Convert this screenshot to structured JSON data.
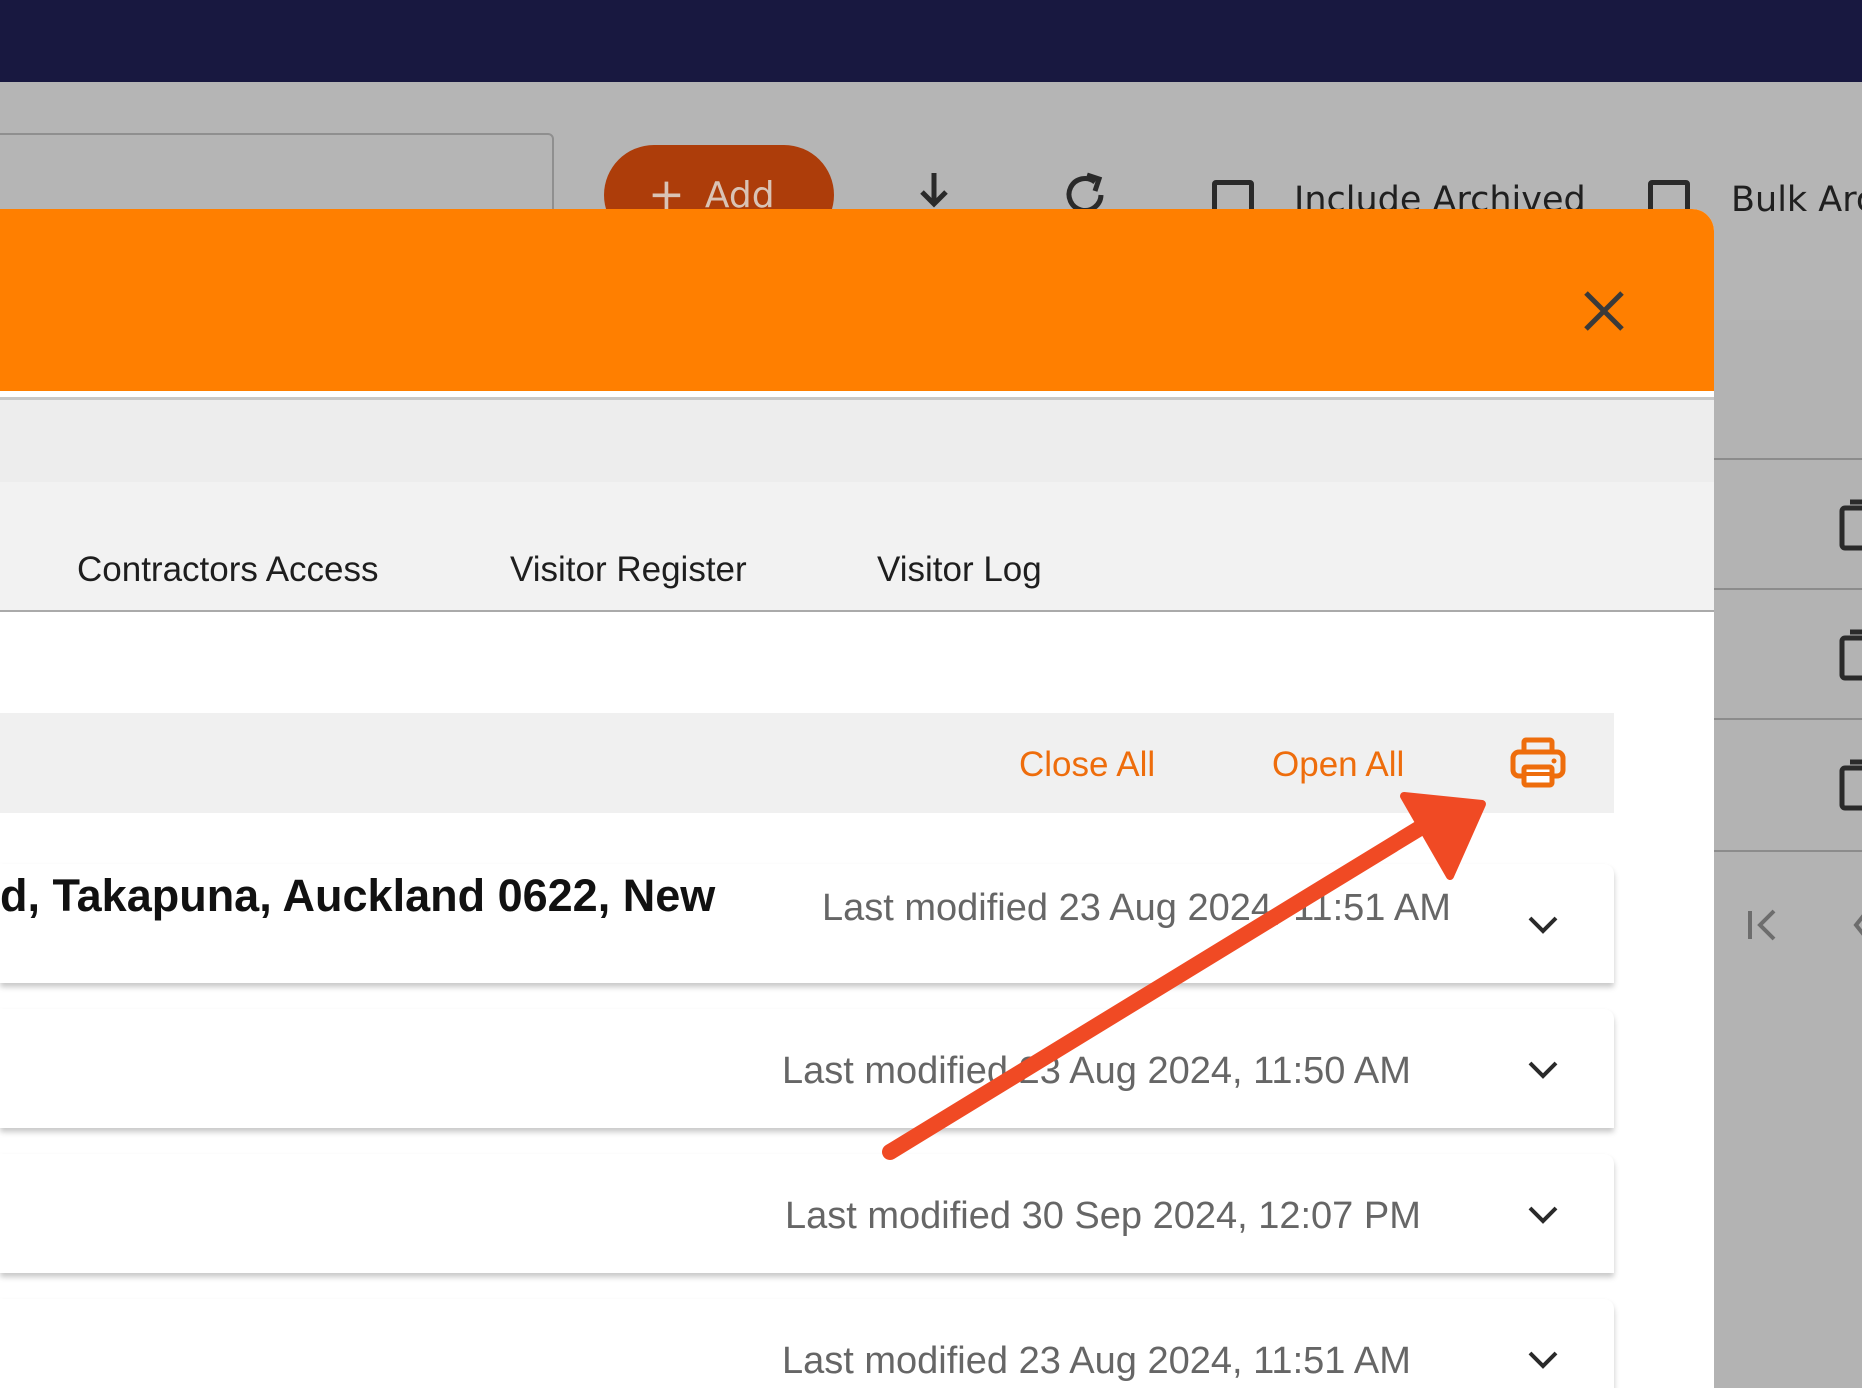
{
  "background": {
    "add_label": "Add",
    "include_archived_label": "Include Archived",
    "bulk_archive_label": "Bulk Arc"
  },
  "modal": {
    "tabs": [
      {
        "label": "Contractors Access"
      },
      {
        "label": "Visitor Register"
      },
      {
        "label": "Visitor Log"
      }
    ],
    "toolbar": {
      "close_all_label": "Close All",
      "open_all_label": "Open All"
    },
    "cards": [
      {
        "title": "d, Takapuna, Auckland 0622, New",
        "meta": "Last modified 23 Aug 2024, 11:51 AM"
      },
      {
        "title": "",
        "meta": "Last modified 23 Aug 2024, 11:50 AM"
      },
      {
        "title": "",
        "meta": "Last modified 30 Sep 2024, 12:07 PM"
      },
      {
        "title": "",
        "meta": "Last modified 23 Aug 2024, 11:51 AM"
      }
    ]
  },
  "colors": {
    "topbar": "#181840",
    "header": "#ff7f00",
    "accent_link": "#ee6d0c",
    "annotation_arrow": "#f04a24"
  },
  "icons": [
    "plus-icon",
    "download-icon",
    "refresh-icon",
    "close-icon",
    "print-icon",
    "chevron-down-icon",
    "copy-icon",
    "first-page-icon"
  ]
}
